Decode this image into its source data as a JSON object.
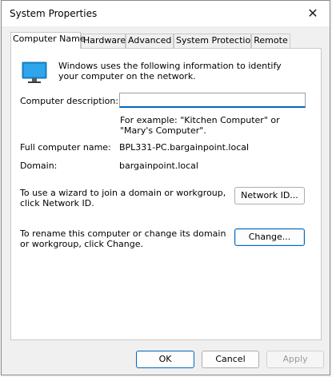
{
  "window": {
    "title": "System Properties",
    "close_glyph": "✕"
  },
  "tabs": [
    {
      "label": "Computer Name",
      "active": true
    },
    {
      "label": "Hardware"
    },
    {
      "label": "Advanced"
    },
    {
      "label": "System Protection"
    },
    {
      "label": "Remote"
    }
  ],
  "panel": {
    "intro": "Windows uses the following information to identify your computer on the network.",
    "desc_label": "Computer description:",
    "desc_value": "",
    "desc_example": "For example: \"Kitchen Computer\" or \"Mary's Computer\".",
    "full_name_label": "Full computer name:",
    "full_name_value": "BPL331-PC.bargainpoint.local",
    "domain_label": "Domain:",
    "domain_value": "bargainpoint.local",
    "network_id_text": "To use a wizard to join a domain or workgroup, click Network ID.",
    "network_id_button": "Network ID...",
    "rename_text": "To rename this computer or change its domain or workgroup, click Change.",
    "change_button": "Change..."
  },
  "footer": {
    "ok": "OK",
    "cancel": "Cancel",
    "apply": "Apply"
  },
  "colors": {
    "accent": "#0067c0",
    "monitor": "#1f8fd6"
  }
}
